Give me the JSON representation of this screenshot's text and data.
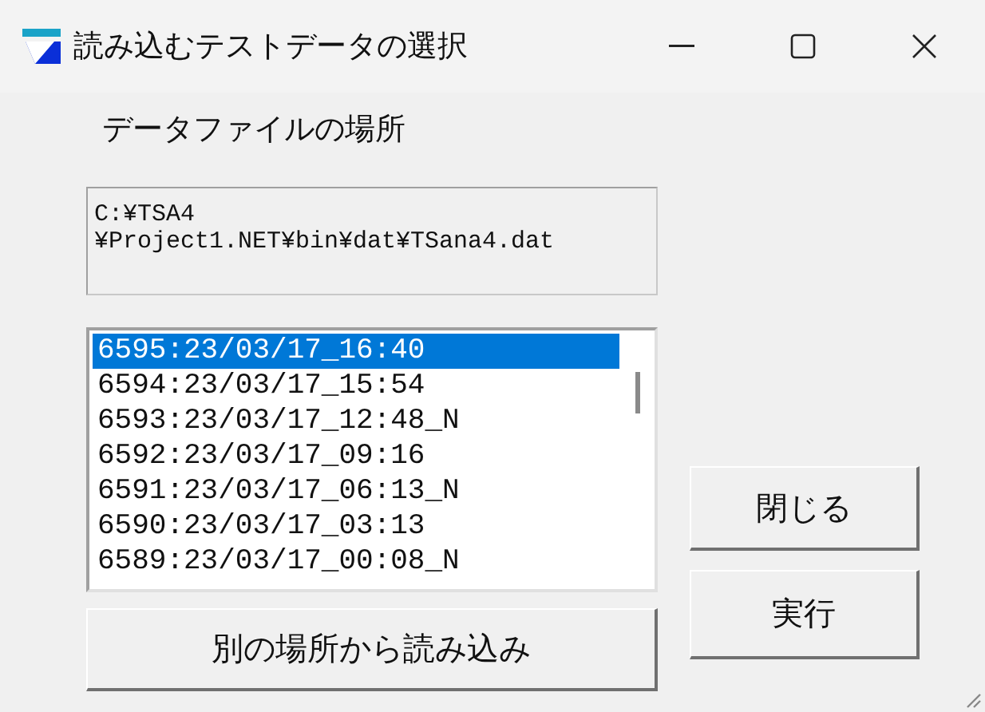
{
  "window": {
    "title": "読み込むテストデータの選択"
  },
  "location_label": "データファイルの場所",
  "path": {
    "lines": [
      "C:¥TSA4",
      "¥Project1.NET¥bin¥dat¥TSana4.dat"
    ]
  },
  "list": {
    "items": [
      {
        "label": "6595:23/03/17_16:40",
        "selected": true
      },
      {
        "label": "6594:23/03/17_15:54",
        "selected": false
      },
      {
        "label": "6593:23/03/17_12:48_N",
        "selected": false
      },
      {
        "label": "6592:23/03/17_09:16",
        "selected": false
      },
      {
        "label": "6591:23/03/17_06:13_N",
        "selected": false
      },
      {
        "label": "6590:23/03/17_03:13",
        "selected": false
      },
      {
        "label": "6589:23/03/17_00:08_N",
        "selected": false
      }
    ]
  },
  "buttons": {
    "load_other": "別の場所から読み込み",
    "close": "閉じる",
    "run": "実行"
  }
}
